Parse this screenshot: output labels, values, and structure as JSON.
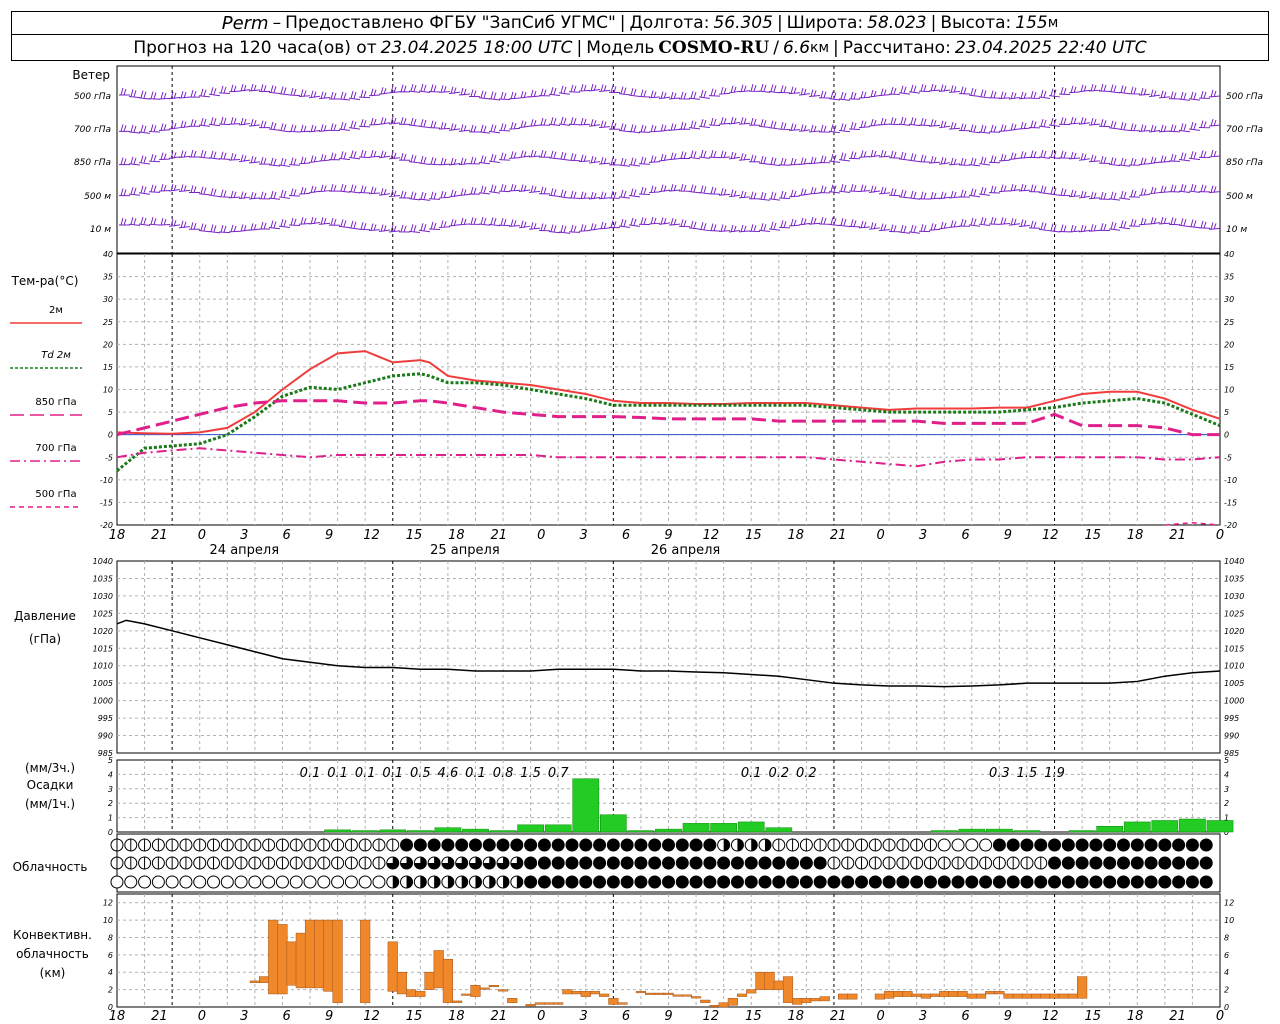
{
  "header": {
    "station": "Perm",
    "provider": "Предоставлено ФГБУ \"ЗапСиб УГМС\"",
    "lon_label": "Долгота:",
    "lon_value": "56.305",
    "lat_label": "Широта:",
    "lat_value": "58.023",
    "alt_label": "Высота:",
    "alt_value": "155",
    "alt_unit": "м",
    "forecast_label": "Прогноз на 120 часа(ов) от",
    "forecast_start": "23.04.2025 18:00 UTC",
    "model_label": "Модель",
    "model_name": "COSMO-RU",
    "model_res": "6.6",
    "model_res_unit": "км",
    "computed_label": "Рассчитано:",
    "computed_at": "23.04.2025 22:40 UTC"
  },
  "wind_panel": {
    "title": "Ветер",
    "levels": [
      "500 гПа",
      "700 гПа",
      "850 гПа",
      "500 м",
      "10 м"
    ]
  },
  "temp_panel": {
    "title": "Тем-ра(°C)",
    "legend": [
      {
        "label": "2м",
        "color": "#f03c3c",
        "dash": "solid"
      },
      {
        "label": "Td 2м",
        "color": "#1a7a1a",
        "dash": "dotted"
      },
      {
        "label": "850 гПа",
        "color": "#e0208a",
        "dash": "long"
      },
      {
        "label": "700 гПа",
        "color": "#e0208a",
        "dash": "dashdot"
      },
      {
        "label": "500 гПа",
        "color": "#e0208a",
        "dash": "short"
      }
    ],
    "ylim": [
      -20,
      40
    ],
    "yticks": [
      "40",
      "35",
      "30",
      "25",
      "20",
      "15",
      "10",
      "5",
      "0",
      "-5",
      "-10",
      "-15",
      "-20"
    ]
  },
  "pressure_panel": {
    "title": "Давление",
    "unit": "(гПа)",
    "ylim": [
      985,
      1040
    ],
    "yticks": [
      "1040",
      "1035",
      "1030",
      "1025",
      "1020",
      "1015",
      "1010",
      "1005",
      "1000",
      "995",
      "990",
      "985"
    ]
  },
  "precip_panel": {
    "title1": "(мм/3ч.)",
    "title2": "Осадки",
    "title3": "(мм/1ч.)",
    "ylim": [
      0,
      5
    ],
    "yticks": [
      "5",
      "4",
      "3",
      "2",
      "1",
      "0"
    ]
  },
  "cloud_panel": {
    "title": "Облачность"
  },
  "conv_panel": {
    "title1": "Конвективн.",
    "title2": "облачность",
    "title3": "(км)",
    "ylim": [
      0,
      13
    ],
    "yticks": [
      "12",
      "10",
      "8",
      "6",
      "4",
      "2",
      "0"
    ]
  },
  "time_axis": {
    "hour_labels": [
      "18",
      "21",
      "0",
      "3",
      "6",
      "9",
      "12",
      "15",
      "18",
      "21",
      "0",
      "3",
      "6",
      "9",
      "12",
      "15",
      "18",
      "21",
      "0",
      "3",
      "6",
      "9",
      "12",
      "15",
      "18",
      "21",
      "0"
    ],
    "day_labels": [
      "24 апреля",
      "25 апреля",
      "26 апреля"
    ]
  },
  "colors": {
    "wind": "#7a22c8",
    "t2m": "#f03c3c",
    "td2m": "#1a7a1a",
    "isobaric": "#e0208a",
    "zero_line": "#3050d0",
    "precip": "#22cc22",
    "convective": "#f0882a",
    "pressure": "#000000",
    "grid": "#b0b0b0"
  },
  "chart_data": [
    {
      "type": "line",
      "title": "Тем-ра(°C)",
      "x": [
        0,
        3,
        6,
        9,
        12,
        15,
        18,
        21,
        24,
        27,
        30,
        33,
        34,
        36,
        39,
        42,
        45,
        48,
        51,
        54,
        57,
        60,
        63,
        66,
        69,
        72,
        75,
        78,
        81,
        84,
        87,
        90,
        93,
        96,
        99,
        102,
        105,
        108,
        111,
        114,
        117,
        120
      ],
      "series": [
        {
          "name": "2м",
          "values": [
            0.5,
            0.3,
            0.2,
            0.5,
            1.5,
            5,
            10,
            14.5,
            18,
            18.5,
            16,
            16.5,
            16,
            13,
            12,
            11.5,
            11,
            10,
            9,
            7.5,
            7,
            7,
            6.8,
            6.8,
            7,
            7,
            7,
            6.5,
            6,
            5.5,
            5.8,
            5.8,
            5.8,
            6,
            6,
            7.5,
            9,
            9.5,
            9.5,
            8,
            5.5,
            3.5
          ]
        },
        {
          "name": "Td 2м",
          "values": [
            -8,
            -3,
            -2.5,
            -2,
            0,
            4,
            8.5,
            10.5,
            10,
            11.5,
            13,
            13.5,
            13,
            11.5,
            11.5,
            11,
            10,
            9,
            8,
            6.5,
            6.5,
            6.5,
            6.5,
            6.5,
            6.5,
            6.5,
            6.5,
            6,
            5.5,
            5,
            5,
            5,
            5,
            5,
            5.5,
            6,
            7,
            7.5,
            8,
            7,
            4.5,
            2
          ]
        },
        {
          "name": "850 гПа",
          "values": [
            0,
            1.5,
            3,
            4.5,
            6,
            7,
            7.5,
            7.5,
            7.5,
            7,
            7,
            7.5,
            7.5,
            7,
            6,
            5,
            4.5,
            4,
            4,
            4,
            3.8,
            3.5,
            3.5,
            3.5,
            3.5,
            3,
            3,
            3,
            3,
            3,
            3,
            2.5,
            2.5,
            2.5,
            2.5,
            4.5,
            2,
            2,
            2,
            1.5,
            0,
            0
          ]
        },
        {
          "name": "700 гПа",
          "values": [
            -5,
            -4,
            -3.5,
            -3,
            -3.5,
            -4,
            -4.5,
            -5,
            -4.5,
            -4.5,
            -4.5,
            -4.5,
            -4.5,
            -4.5,
            -4.5,
            -4.5,
            -4.5,
            -5,
            -5,
            -5,
            -5,
            -5,
            -5,
            -5,
            -5,
            -5,
            -5,
            -5.5,
            -6,
            -6.5,
            -7,
            -6,
            -5.5,
            -5.5,
            -5,
            -5,
            -5,
            -5,
            -5,
            -5.5,
            -5.5,
            -5
          ]
        },
        {
          "name": "500 гПа",
          "values": [
            null,
            null,
            null,
            null,
            null,
            null,
            null,
            null,
            null,
            null,
            null,
            null,
            null,
            null,
            null,
            null,
            null,
            null,
            null,
            null,
            null,
            null,
            null,
            null,
            null,
            null,
            null,
            null,
            null,
            null,
            null,
            null,
            null,
            null,
            null,
            null,
            null,
            null,
            null,
            -20,
            -19.5,
            -20
          ]
        }
      ]
    },
    {
      "type": "line",
      "title": "Давление",
      "x": [
        0,
        1,
        3,
        6,
        9,
        12,
        15,
        18,
        21,
        24,
        27,
        30,
        33,
        36,
        39,
        42,
        45,
        48,
        51,
        54,
        57,
        60,
        63,
        66,
        69,
        72,
        75,
        78,
        81,
        84,
        87,
        90,
        93,
        96,
        99,
        102,
        105,
        108,
        111,
        114,
        117,
        120
      ],
      "series": [
        {
          "name": "Давление",
          "values": [
            1022,
            1023,
            1022,
            1020,
            1018,
            1016,
            1014,
            1012,
            1011,
            1010,
            1009.5,
            1009.5,
            1009,
            1009,
            1008.5,
            1008.5,
            1008.5,
            1009,
            1009,
            1009,
            1008.5,
            1008.5,
            1008.2,
            1008,
            1007.5,
            1007,
            1006,
            1005,
            1004.5,
            1004.2,
            1004.2,
            1004,
            1004.2,
            1004.5,
            1005,
            1005,
            1005,
            1005,
            1005.5,
            1007,
            1008,
            1008.5
          ]
        }
      ]
    },
    {
      "type": "bar",
      "title": "Осадки",
      "x": [
        24,
        27,
        30,
        33,
        36,
        39,
        42,
        45,
        48,
        51,
        54,
        57,
        60,
        63,
        66,
        69,
        72,
        90,
        93,
        96,
        99,
        105,
        108,
        111,
        114,
        117,
        120
      ],
      "series": [
        {
          "name": "мм/1ч",
          "values": [
            0.15,
            0.1,
            0.15,
            0.1,
            0.3,
            0.2,
            0.1,
            0.5,
            0.5,
            3.7,
            1.2,
            0.1,
            0.2,
            0.6,
            0.6,
            0.7,
            0.3,
            0.1,
            0.2,
            0.2,
            0.1,
            0.1,
            0.4,
            0.7,
            0.8,
            0.9,
            0.8
          ]
        }
      ],
      "labels_3h": [
        {
          "x": 21,
          "text": "0.1"
        },
        {
          "x": 24,
          "text": "0.1"
        },
        {
          "x": 27,
          "text": "0.1"
        },
        {
          "x": 30,
          "text": "0.1"
        },
        {
          "x": 33,
          "text": "0.5"
        },
        {
          "x": 36,
          "text": "4.6"
        },
        {
          "x": 39,
          "text": "0.1"
        },
        {
          "x": 42,
          "text": "0.8"
        },
        {
          "x": 45,
          "text": "1.5"
        },
        {
          "x": 48,
          "text": "0.7"
        },
        {
          "x": 69,
          "text": "0.1"
        },
        {
          "x": 72,
          "text": "0.2"
        },
        {
          "x": 75,
          "text": "0.2"
        },
        {
          "x": 96,
          "text": "0.3"
        },
        {
          "x": 99,
          "text": "1.5"
        },
        {
          "x": 102,
          "text": "1.9"
        }
      ]
    },
    {
      "type": "bar",
      "title": "Конвективн. облачность (км)",
      "x": [
        15,
        16,
        17,
        18,
        19,
        20,
        21,
        22,
        23,
        24,
        27,
        30,
        31,
        32,
        33,
        34,
        35,
        36,
        37,
        38,
        39,
        40,
        41,
        42,
        43,
        45,
        46,
        47,
        48,
        49,
        50,
        51,
        52,
        53,
        54,
        55,
        57,
        58,
        59,
        60,
        61,
        62,
        63,
        64,
        65,
        66,
        67,
        68,
        69,
        70,
        71,
        72,
        73,
        74,
        75,
        76,
        77,
        79,
        80,
        83,
        84,
        85,
        86,
        87,
        88,
        89,
        90,
        91,
        92,
        93,
        94,
        95,
        96,
        97,
        98,
        99,
        100,
        101,
        102,
        103,
        104,
        105
      ],
      "series": [
        {
          "name": "нижняя граница (км)",
          "values": [
            2.8,
            2.8,
            1.5,
            1.5,
            2.5,
            2.2,
            2.2,
            2.2,
            1.8,
            0.5,
            0.5,
            1.8,
            1.5,
            1.2,
            1.2,
            2.0,
            2.2,
            0.5,
            0.5,
            1.5,
            1.2,
            2.2,
            2.5,
            2.0,
            0.5,
            0.2,
            0.3,
            0.3,
            0.3,
            1.5,
            1.5,
            1.2,
            1.5,
            1.2,
            0.3,
            0.3,
            1.8,
            1.6,
            1.6,
            1.6,
            1.4,
            1.4,
            1.2,
            0.5,
            0.2,
            0.0,
            0.2,
            1.2,
            1.6,
            2.0,
            2.0,
            2.0,
            0.5,
            0.3,
            0.5,
            0.7,
            0.7,
            0.9,
            0.9,
            0.9,
            1.0,
            1.2,
            1.2,
            1.2,
            1.0,
            1.2,
            1.2,
            1.2,
            1.2,
            1.0,
            1.0,
            1.5,
            1.5,
            1.0,
            1.0,
            1.0,
            1.0,
            1.0,
            1.0,
            1.0,
            1.0,
            1.0
          ]
        },
        {
          "name": "верхняя граница (км)",
          "values": [
            3.0,
            3.5,
            10,
            9.5,
            7.5,
            8.5,
            10,
            10,
            10,
            10,
            10,
            7.5,
            4.0,
            2.0,
            1.8,
            4.0,
            6.5,
            5.5,
            0.7,
            1.5,
            2.5,
            2.2,
            2.5,
            2.0,
            1.0,
            0.3,
            0.5,
            0.5,
            0.5,
            2.0,
            1.8,
            1.8,
            1.8,
            1.5,
            1.0,
            0.5,
            1.8,
            1.6,
            1.6,
            1.6,
            1.4,
            1.4,
            1.2,
            0.8,
            0.2,
            0.5,
            1.0,
            1.5,
            2.0,
            4.0,
            4.0,
            3.0,
            3.5,
            1.0,
            1.0,
            1.0,
            1.2,
            1.5,
            1.5,
            1.5,
            1.8,
            1.8,
            1.8,
            1.5,
            1.5,
            1.5,
            1.8,
            1.8,
            1.8,
            1.5,
            1.5,
            1.8,
            1.8,
            1.5,
            1.5,
            1.5,
            1.5,
            1.5,
            1.5,
            1.5,
            1.5,
            3.5
          ]
        }
      ]
    }
  ]
}
